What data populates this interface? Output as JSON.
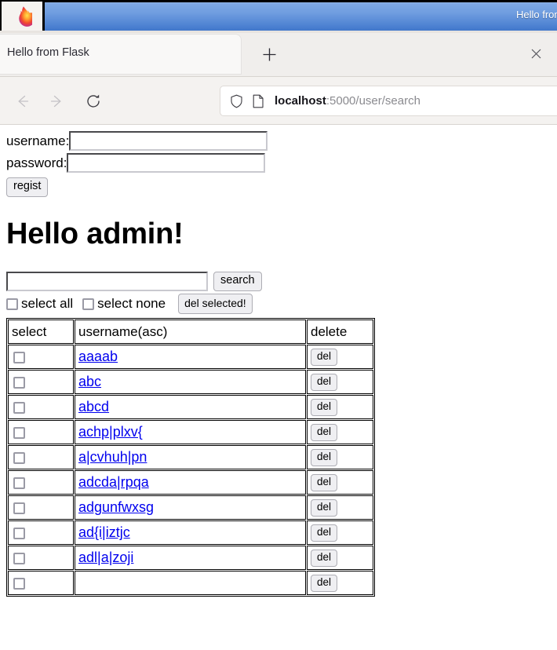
{
  "window": {
    "title": "Hello from Flask",
    "logo_icon": "firefox-logo"
  },
  "tabs": {
    "active_tab_title": "Hello from Flask",
    "close_icon": "close-icon",
    "new_tab_icon": "plus-icon"
  },
  "toolbar": {
    "back_icon": "back-arrow-icon",
    "forward_icon": "forward-arrow-icon",
    "reload_icon": "reload-icon",
    "shield_icon": "shield-icon",
    "page_icon": "page-document-icon",
    "url_host": "localhost",
    "url_path": ":5000/user/search"
  },
  "page": {
    "register_form": {
      "username_label": "username:",
      "username_value": "",
      "username_placeholder": "",
      "password_label": "password:",
      "password_value": "",
      "password_placeholder": "",
      "submit_label": "regist"
    },
    "heading": "Hello admin!",
    "search": {
      "value": "",
      "placeholder": "",
      "button_label": "search"
    },
    "bulk_actions": {
      "select_all_label": "select all",
      "select_none_label": "select none",
      "delete_selected_label": "del selected!"
    },
    "table": {
      "columns": [
        "select",
        "username(asc)",
        "delete"
      ],
      "delete_button_label": "del",
      "rows": [
        {
          "username": "aaaab",
          "selected": false
        },
        {
          "username": "abc",
          "selected": false
        },
        {
          "username": "abcd",
          "selected": false
        },
        {
          "username": "achp|plxv{",
          "selected": false
        },
        {
          "username": "a|cvhuh|pn",
          "selected": false
        },
        {
          "username": "adcda|rpqa",
          "selected": false
        },
        {
          "username": "adgunfwxsg",
          "selected": false
        },
        {
          "username": "ad{i|iztjc",
          "selected": false
        },
        {
          "username": "adl|a|zoji",
          "selected": false
        },
        {
          "username": "",
          "selected": false
        }
      ]
    }
  },
  "colors": {
    "titlebar_gradient_top": "#7fa9e4",
    "titlebar_gradient_bottom": "#3f75c9",
    "link": "#0000ee",
    "chrome_bg": "#f4f2f0"
  }
}
